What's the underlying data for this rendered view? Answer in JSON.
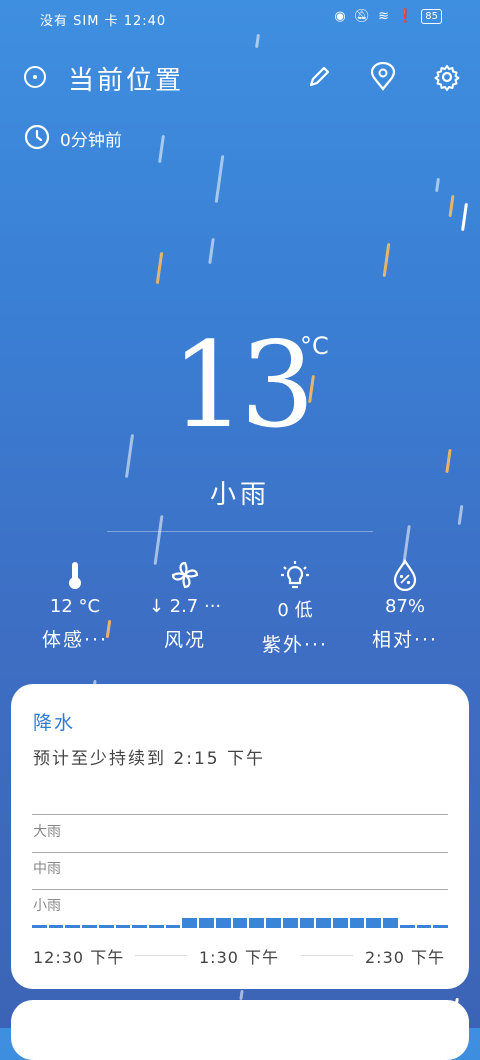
{
  "status_bar": {
    "left_text": "没有 SIM 卡 12:40",
    "battery": "85"
  },
  "header": {
    "location": "当前位置",
    "updated": "0分钟前"
  },
  "weather": {
    "temperature": "13",
    "unit": "°C",
    "condition": "小雨"
  },
  "metrics": [
    {
      "icon": "thermometer-icon",
      "value": "12 °C",
      "label": "体感···"
    },
    {
      "icon": "wind-icon",
      "value": "↓ 2.7 ···",
      "label": "风况"
    },
    {
      "icon": "uv-sun-icon",
      "value": "0 低",
      "label": "紫外···"
    },
    {
      "icon": "humidity-drop-icon",
      "value": "87%",
      "label": "相对···"
    }
  ],
  "precip_card": {
    "title": "降水",
    "subtitle": "预计至少持续到 2:15 下午",
    "levels": [
      "大雨",
      "中雨",
      "小雨"
    ],
    "intensity": [
      0.3,
      0.3,
      0.3,
      0.3,
      0.3,
      0.3,
      0.3,
      0.3,
      0.3,
      1,
      1,
      1,
      1,
      1,
      1,
      1,
      1,
      1,
      1,
      1,
      1,
      1,
      0.3,
      0.3,
      0.3
    ],
    "times": [
      "12:30 下午",
      "1:30 下午",
      "2:30 下午"
    ]
  },
  "colors": {
    "accent": "#2f7cd3",
    "bar": "#3a85d8"
  }
}
